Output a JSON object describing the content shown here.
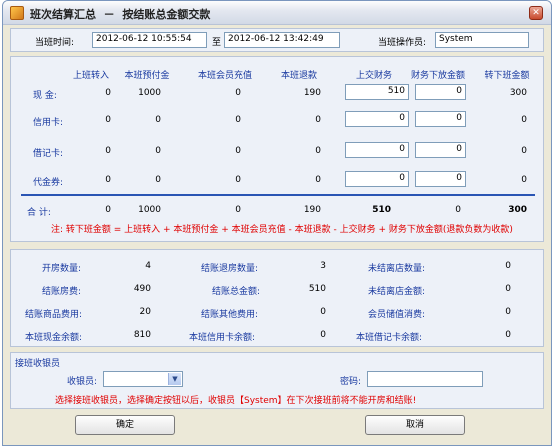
{
  "window": {
    "title": "班次结算汇总  －  按结账总金额交款",
    "close_glyph": "✕"
  },
  "top": {
    "time_label": "当班时间:",
    "start_time": "2012-06-12 10:55:54",
    "to_label": "至",
    "end_time": "2012-06-12 13:42:49",
    "operator_label": "当班操作员:",
    "operator": "System"
  },
  "table": {
    "headers": [
      "上班转入",
      "本班预付金",
      "本班会员充值",
      "本班退款",
      "上交财务",
      "财务下放金额",
      "转下班金额"
    ],
    "rows": [
      {
        "label": "现  金:",
        "carry_in": "0",
        "prepay": "1000",
        "member_topup": "0",
        "refund": "190",
        "to_finance": "510",
        "finance_out": "0",
        "carry_out": "300"
      },
      {
        "label": "信用卡:",
        "carry_in": "0",
        "prepay": "0",
        "member_topup": "0",
        "refund": "0",
        "to_finance": "0",
        "finance_out": "0",
        "carry_out": "0"
      },
      {
        "label": "借记卡:",
        "carry_in": "0",
        "prepay": "0",
        "member_topup": "0",
        "refund": "0",
        "to_finance": "0",
        "finance_out": "0",
        "carry_out": "0"
      },
      {
        "label": "代金券:",
        "carry_in": "0",
        "prepay": "0",
        "member_topup": "0",
        "refund": "0",
        "to_finance": "0",
        "finance_out": "0",
        "carry_out": "0"
      }
    ],
    "total": {
      "label": "合  计:",
      "carry_in": "0",
      "prepay": "1000",
      "member_topup": "0",
      "refund": "190",
      "to_finance": "510",
      "finance_out": "0",
      "carry_out": "300"
    },
    "note": "注: 转下班金额 = 上班转入 + 本班预付金 + 本班会员充值 - 本班退款 - 上交财务 + 财务下放金额(退款负数为收款)"
  },
  "stats": {
    "rows": [
      [
        {
          "label": "开房数量:",
          "value": "4"
        },
        {
          "label": "结账退房数量:",
          "value": "3"
        },
        {
          "label": "未结离店数量:",
          "value": "0"
        }
      ],
      [
        {
          "label": "结账房费:",
          "value": "490"
        },
        {
          "label": "结账总金额:",
          "value": "510"
        },
        {
          "label": "未结离店金额:",
          "value": "0"
        }
      ],
      [
        {
          "label": "结账商品费用:",
          "value": "20"
        },
        {
          "label": "结账其他费用:",
          "value": "0"
        },
        {
          "label": "会员储值消费:",
          "value": "0"
        }
      ],
      [
        {
          "label": "本班现金余额:",
          "value": "810"
        },
        {
          "label": "本班信用卡余额:",
          "value": "0"
        },
        {
          "label": "本班借记卡余额:",
          "value": "0"
        }
      ]
    ]
  },
  "handover": {
    "group_label": "接班收银员",
    "cashier_label": "收银员:",
    "cashier_value": "",
    "password_label": "密码:",
    "password_value": "",
    "warning": "选择接班收银员，选择确定按钮以后，收银员【System】在下次接班前将不能开房和结账!"
  },
  "buttons": {
    "ok": "确定",
    "cancel": "取消"
  }
}
